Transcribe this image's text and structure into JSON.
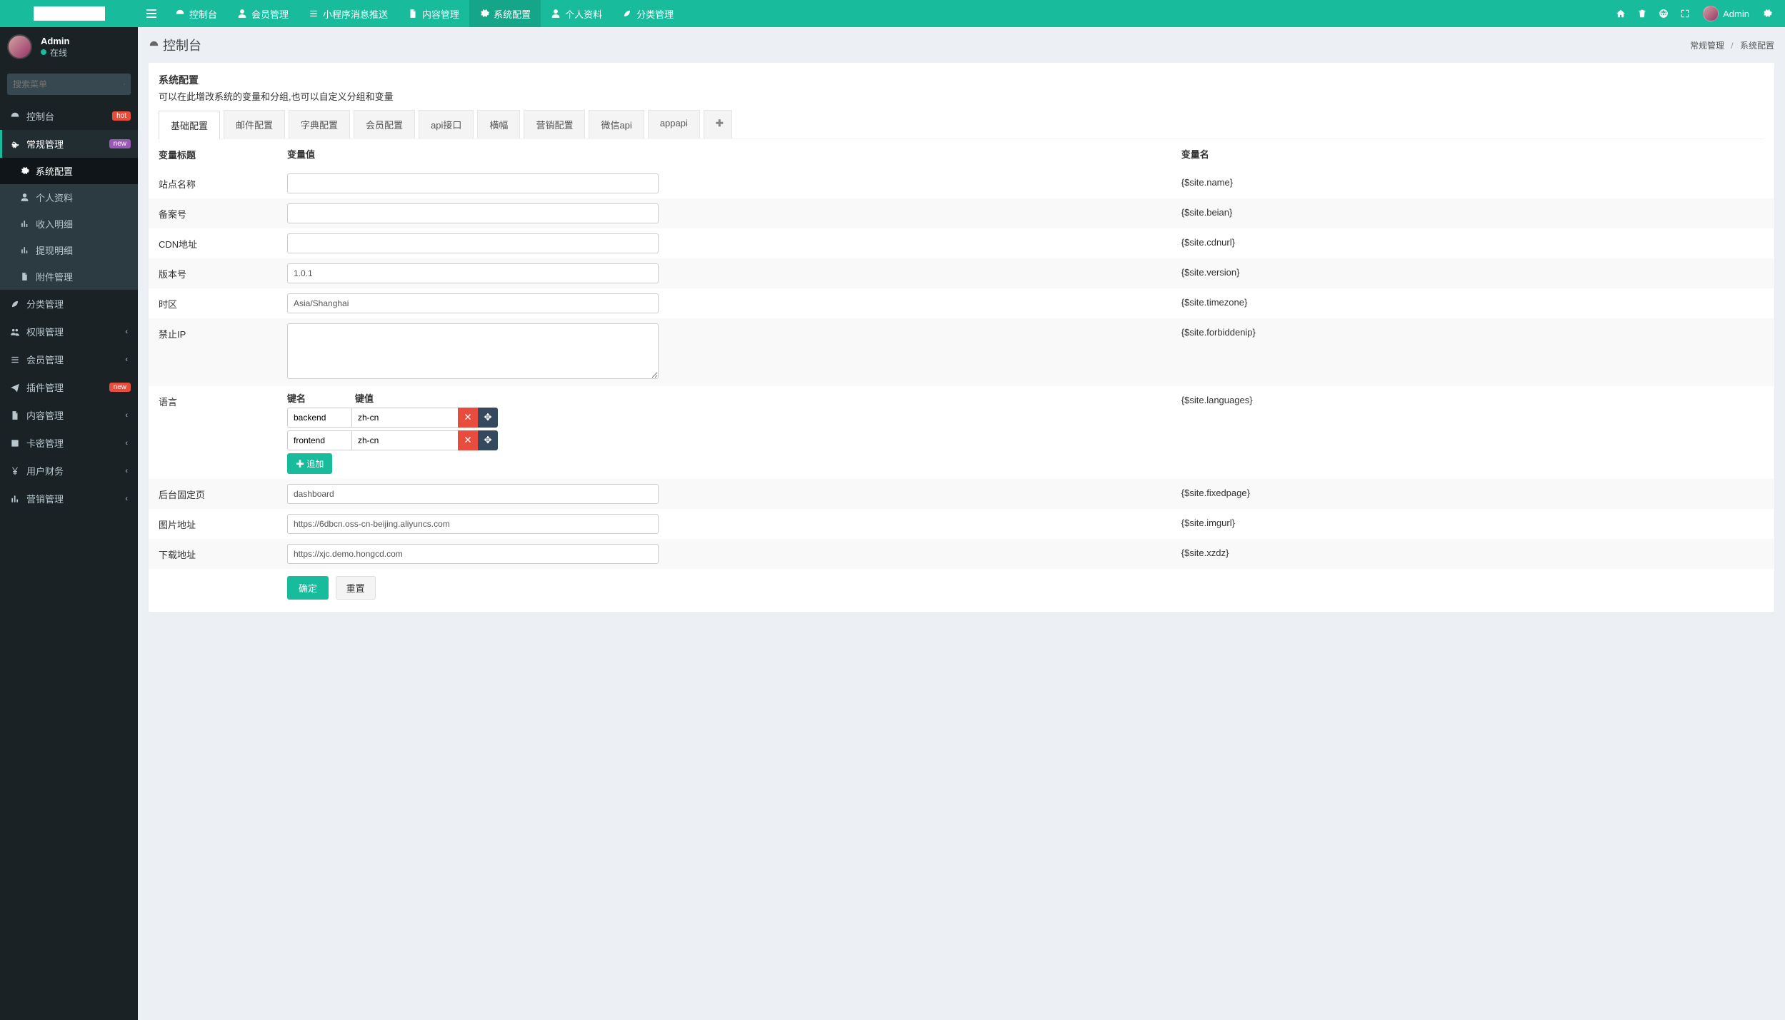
{
  "topnav": {
    "items": [
      {
        "label": "控制台",
        "icon": "dashboard"
      },
      {
        "label": "会员管理",
        "icon": "user"
      },
      {
        "label": "小程序消息推送",
        "icon": "list"
      },
      {
        "label": "内容管理",
        "icon": "file"
      },
      {
        "label": "系统配置",
        "icon": "cog",
        "active": true
      },
      {
        "label": "个人资料",
        "icon": "user"
      },
      {
        "label": "分类管理",
        "icon": "leaf"
      }
    ],
    "user": "Admin"
  },
  "sidebar": {
    "user_name": "Admin",
    "user_status": "在线",
    "search_placeholder": "搜索菜单",
    "menu": [
      {
        "label": "控制台",
        "icon": "dashboard",
        "badge": "hot",
        "badge_class": "hot"
      },
      {
        "label": "常规管理",
        "icon": "cogs",
        "badge": "new",
        "badge_class": "new",
        "active": true,
        "children": [
          {
            "label": "系统配置",
            "icon": "cog",
            "active": true
          },
          {
            "label": "个人资料",
            "icon": "user"
          },
          {
            "label": "收入明细",
            "icon": "bar"
          },
          {
            "label": "提现明细",
            "icon": "bar"
          },
          {
            "label": "附件管理",
            "icon": "file"
          }
        ]
      },
      {
        "label": "分类管理",
        "icon": "leaf"
      },
      {
        "label": "权限管理",
        "icon": "group",
        "chev": true
      },
      {
        "label": "会员管理",
        "icon": "list",
        "chev": true
      },
      {
        "label": "插件管理",
        "icon": "send",
        "badge": "new",
        "badge_class": "newr",
        "chev": true
      },
      {
        "label": "内容管理",
        "icon": "file",
        "chev": true
      },
      {
        "label": "卡密管理",
        "icon": "image",
        "chev": true
      },
      {
        "label": "用户财务",
        "icon": "yen",
        "chev": true
      },
      {
        "label": "营销管理",
        "icon": "bar",
        "chev": true
      }
    ]
  },
  "breadcrumb": {
    "left": "控制台",
    "right": [
      "常规管理",
      "系统配置"
    ]
  },
  "panel": {
    "title": "系统配置",
    "subtitle": "可以在此增改系统的变量和分组,也可以自定义分组和变量"
  },
  "tabs": [
    "基础配置",
    "邮件配置",
    "字典配置",
    "会员配置",
    "api接口",
    "横幅",
    "营销配置",
    "微信api",
    "appapi"
  ],
  "table": {
    "headers": {
      "title": "变量标题",
      "value": "变量值",
      "var": "变量名"
    },
    "rows": [
      {
        "title": "站点名称",
        "value": "",
        "var": "{$site.name}"
      },
      {
        "title": "备案号",
        "value": "",
        "var": "{$site.beian}"
      },
      {
        "title": "CDN地址",
        "value": "",
        "var": "{$site.cdnurl}"
      },
      {
        "title": "版本号",
        "value": "1.0.1",
        "var": "{$site.version}"
      },
      {
        "title": "时区",
        "value": "Asia/Shanghai",
        "var": "{$site.timezone}"
      },
      {
        "title": "禁止IP",
        "value": "",
        "var": "{$site.forbiddenip}",
        "type": "textarea"
      },
      {
        "title": "语言",
        "var": "{$site.languages}",
        "type": "kv",
        "kv_headers": {
          "key": "键名",
          "val": "键值"
        },
        "kv": [
          {
            "k": "backend",
            "v": "zh-cn"
          },
          {
            "k": "frontend",
            "v": "zh-cn"
          }
        ],
        "add_label": "追加"
      },
      {
        "title": "后台固定页",
        "value": "dashboard",
        "var": "{$site.fixedpage}"
      },
      {
        "title": "图片地址",
        "value": "https://6dbcn.oss-cn-beijing.aliyuncs.com",
        "var": "{$site.imgurl}"
      },
      {
        "title": "下载地址",
        "value": "https://xjc.demo.hongcd.com",
        "var": "{$site.xzdz}"
      }
    ]
  },
  "buttons": {
    "submit": "确定",
    "reset": "重置"
  }
}
